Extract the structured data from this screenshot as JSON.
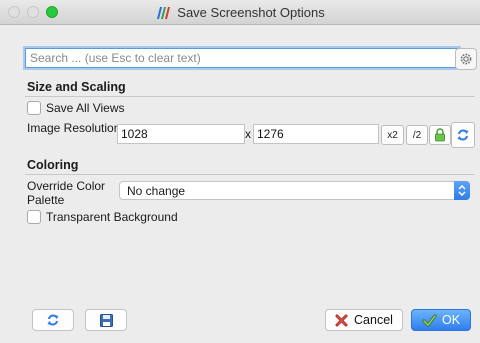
{
  "window": {
    "title": "Save Screenshot Options"
  },
  "search": {
    "placeholder": "Search ... (use Esc to clear text)",
    "value": ""
  },
  "size_scaling": {
    "heading": "Size and Scaling",
    "save_all_views_label": "Save All Views",
    "save_all_views_checked": false,
    "resolution_label": "Image Resolution",
    "width": "1028",
    "separator": "x",
    "height": "1276",
    "double_label": "x2",
    "half_label": "/2"
  },
  "coloring": {
    "heading": "Coloring",
    "override_label_line1": "Override Color",
    "override_label_line2": "Palette",
    "palette_selected": "No change",
    "transparent_label": "Transparent Background",
    "transparent_checked": false
  },
  "footer": {
    "cancel_label": "Cancel",
    "ok_label": "OK"
  },
  "colors": {
    "accent": "#2f7de6",
    "focus_ring": "#a9c9ef"
  }
}
